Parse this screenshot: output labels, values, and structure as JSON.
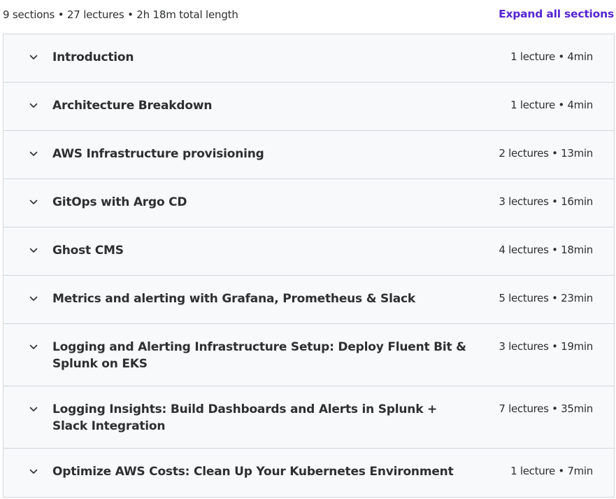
{
  "summary": {
    "text": "9 sections • 27 lectures • 2h 18m total length",
    "expand_label": "Expand all sections"
  },
  "accent_color": "#5624d0",
  "sections": [
    {
      "title": "Introduction",
      "meta": "1 lecture • 4min"
    },
    {
      "title": "Architecture Breakdown",
      "meta": "1 lecture • 4min"
    },
    {
      "title": "AWS Infrastructure provisioning",
      "meta": "2 lectures • 13min"
    },
    {
      "title": "GitOps with Argo CD",
      "meta": "3 lectures • 16min"
    },
    {
      "title": "Ghost CMS",
      "meta": "4 lectures • 18min"
    },
    {
      "title": "Metrics and alerting with Grafana, Prometheus & Slack",
      "meta": "5 lectures • 23min"
    },
    {
      "title": "Logging and Alerting Infrastructure Setup: Deploy Fluent Bit & Splunk on EKS",
      "meta": "3 lectures • 19min"
    },
    {
      "title": "Logging Insights: Build Dashboards and Alerts in Splunk + Slack Integration",
      "meta": "7 lectures • 35min"
    },
    {
      "title": "Optimize AWS Costs: Clean Up Your Kubernetes Environment",
      "meta": "1 lecture • 7min"
    }
  ],
  "icons": {
    "expand": "chevron-down-icon"
  }
}
